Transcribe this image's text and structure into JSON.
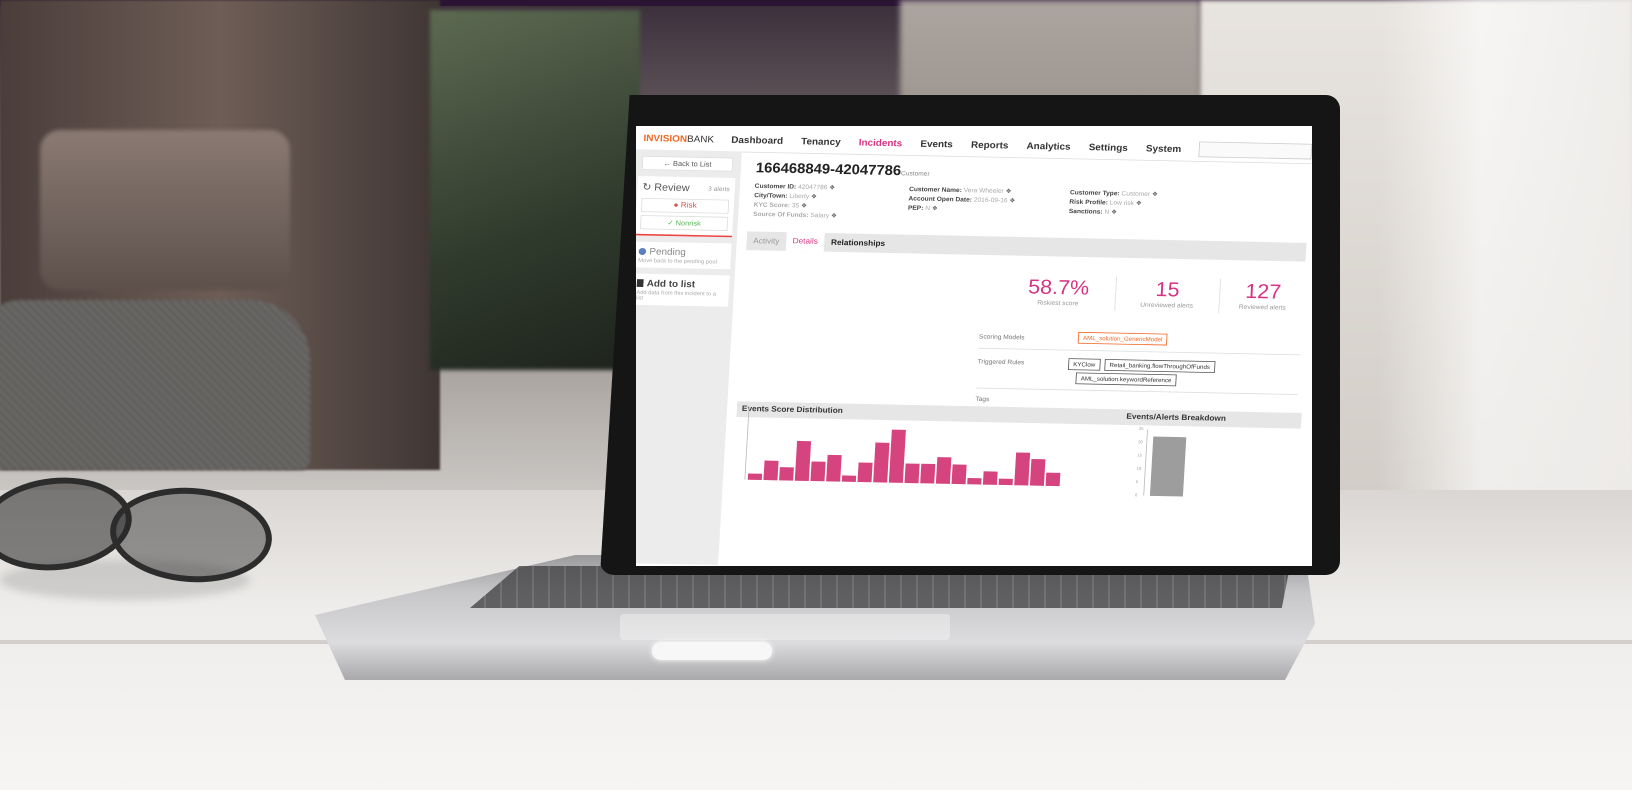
{
  "nav": {
    "logo_brand": "INVISION",
    "logo_suffix": "BANK",
    "items": [
      "Dashboard",
      "Tenancy",
      "Incidents",
      "Events",
      "Reports",
      "Analytics",
      "Settings",
      "System"
    ],
    "active_item": "Incidents"
  },
  "sidebar": {
    "back_label": "Back to List",
    "review_title": "Review",
    "review_count": "3 alerts",
    "risk_label": "Risk",
    "nonrisk_label": "Nonrisk",
    "pending_title": "Pending",
    "pending_sub": "Move back to the pending pool",
    "addlist_title": "Add to list",
    "addlist_sub": "Add data from this incident to a list"
  },
  "customer": {
    "id": "166468849-42047786",
    "type_tag": "Customer",
    "fields_col1": [
      {
        "k": "Customer ID:",
        "v": "42047786"
      },
      {
        "k": "City/Town:",
        "v": "Liberty"
      },
      {
        "k": "KYC Score:",
        "v": "35"
      },
      {
        "k": "Source Of Funds:",
        "v": "Salary"
      }
    ],
    "fields_col2": [
      {
        "k": "Customer Name:",
        "v": "Vera Wheeler"
      },
      {
        "k": "Account Open Date:",
        "v": "2016-09-16"
      },
      {
        "k": "PEP:",
        "v": "N"
      }
    ],
    "fields_col3": [
      {
        "k": "Customer Type:",
        "v": "Customer"
      },
      {
        "k": "Risk Profile:",
        "v": "Low risk"
      },
      {
        "k": "Sanctions:",
        "v": "N"
      }
    ]
  },
  "tabs": [
    "Activity",
    "Details",
    "Relationships"
  ],
  "selected_tab": "Details",
  "stats": [
    {
      "value": "58.7%",
      "label": "Riskiest score"
    },
    {
      "value": "15",
      "label": "Unreviewed alerts"
    },
    {
      "value": "127",
      "label": "Reviewed alerts"
    }
  ],
  "details": {
    "scoring_label": "Scoring Models",
    "scoring_chip": "AML_solution_GenericModel",
    "rules_label": "Triggered Rules",
    "rules_chips": [
      "KYClow",
      "Retail_banking.flowThroughOfFunds",
      "AML_solution.keywordReference"
    ],
    "tags_label": "Tags"
  },
  "panels": {
    "distribution_title": "Events Score Distribution",
    "breakdown_title": "Events/Alerts Breakdown"
  },
  "chart_data": [
    {
      "type": "bar",
      "title": "Events Score Distribution",
      "values": [
        1,
        3,
        2,
        6,
        3,
        4,
        1,
        3,
        6,
        8,
        3,
        3,
        4,
        3,
        1,
        2,
        1,
        5,
        4,
        2
      ],
      "ylim": [
        0,
        10
      ],
      "color": "#d6447f"
    },
    {
      "type": "bar",
      "title": "Events/Alerts Breakdown",
      "values": [
        24
      ],
      "ylim": [
        0,
        27
      ],
      "y_ticks": [
        "25",
        "20",
        "15",
        "10",
        "5",
        "0"
      ],
      "color": "#9d9d9d"
    }
  ]
}
